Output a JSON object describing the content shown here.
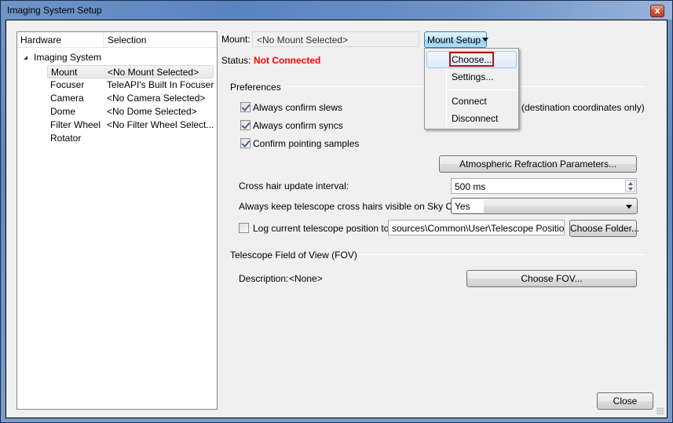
{
  "window": {
    "title": "Imaging System Setup",
    "close_glyph": "x"
  },
  "tree": {
    "columns": {
      "hardware": "Hardware",
      "selection": "Selection"
    },
    "root": "Imaging System",
    "items": [
      {
        "hardware": "Mount",
        "selection": "<No Mount Selected>",
        "selected": true
      },
      {
        "hardware": "Focuser",
        "selection": "TeleAPI's Built In Focuser"
      },
      {
        "hardware": "Camera",
        "selection": "<No Camera Selected>"
      },
      {
        "hardware": "Dome",
        "selection": "<No Dome Selected>"
      },
      {
        "hardware": "Filter Wheel",
        "selection": "<No Filter Wheel Select..."
      },
      {
        "hardware": "Rotator",
        "selection": ""
      }
    ]
  },
  "mount": {
    "label": "Mount:",
    "value": "<No Mount Selected>",
    "setup_button": "Mount Setup",
    "status_label": "Status:",
    "status_value": "Not Connected",
    "status_color": "#ff0000"
  },
  "menu": {
    "items": [
      {
        "label": "Choose...",
        "highlighted": true
      },
      {
        "label": "Settings..."
      },
      {
        "label": "Connect"
      },
      {
        "label": "Disconnect"
      }
    ]
  },
  "preferences": {
    "title": "Preferences",
    "checkboxes": [
      {
        "label": "Always confirm slews",
        "checked": true
      },
      {
        "label": "Always confirm syncs",
        "checked": true
      },
      {
        "label": "Confirm pointing samples",
        "checked": true
      }
    ],
    "partial_label": "(destination coordinates only)",
    "atmos_button": "Atmospheric Refraction Parameters...",
    "crosshair_interval_label": "Cross hair update interval:",
    "crosshair_interval_value": "500 ms",
    "keep_visible_label": "Always keep telescope cross hairs visible on Sky Chart:",
    "keep_visible_value": "Yes",
    "log_label": "Log current telescope position to:",
    "log_checked": false,
    "log_path": "sources\\Common\\User\\Telescope Position.txt",
    "choose_folder_button": "Choose Folder..."
  },
  "fov": {
    "title": "Telescope Field of View (FOV)",
    "description_label": "Description:",
    "description_value": "<None>",
    "choose_button": "Choose FOV..."
  },
  "footer": {
    "close_button": "Close"
  }
}
